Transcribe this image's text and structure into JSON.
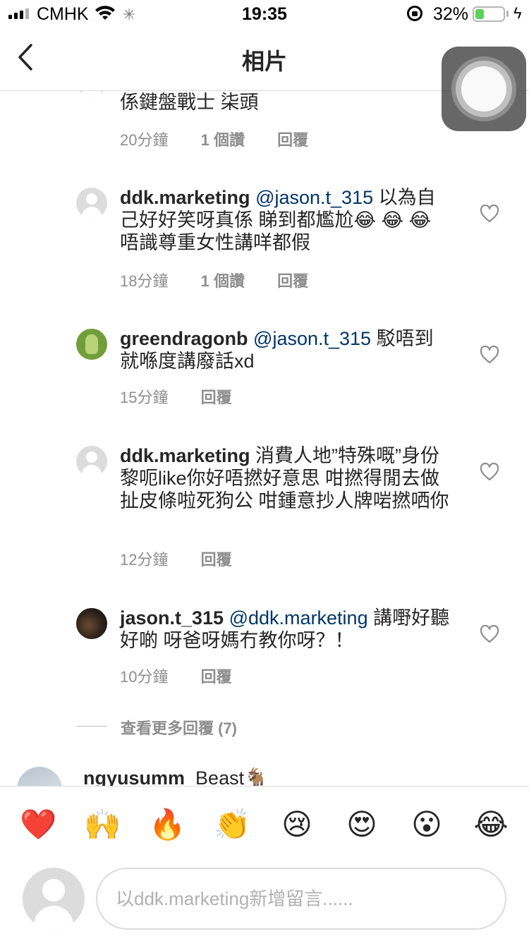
{
  "status_bar": {
    "carrier": "CMHK",
    "time": "19:35",
    "battery_percent": "32%",
    "battery_level": 0.32,
    "battery_color": "#5ad358"
  },
  "nav": {
    "title": "相片",
    "back_icon": "chevron-left-icon"
  },
  "comments": {
    "partial_top": {
      "text": "係鍵盤戰士 柒頭",
      "time": "20分鐘",
      "likes": "1 個讚",
      "reply": "回覆"
    },
    "items": [
      {
        "username": "ddk.marketing",
        "mention": "@jason.t_315",
        "text": " 以為自己好好笑呀真係 睇到都尷尬😂 😂 😂 唔識尊重女性講咩都假",
        "time": "18分鐘",
        "likes": "1 個讚",
        "reply": "回覆"
      },
      {
        "username": "greendragonb",
        "mention": "@jason.t_315",
        "text": " 駁唔到就喺度講廢話xd",
        "time": "15分鐘",
        "reply": "回覆"
      },
      {
        "username": "ddk.marketing",
        "mention": "",
        "text": " 消費人地”特殊嘅”身份黎呃like你好唔撚好意思 咁撚得閒去做扯皮條啦死狗公 咁鍾意抄人牌啱撚哂你",
        "time": "12分鐘",
        "reply": "回覆"
      },
      {
        "username": "jason.t_315",
        "mention": "@ddk.marketing",
        "text": " 講嘢好聽好啲 呀爸呀媽冇教你呀？！",
        "time": "10分鐘",
        "reply": "回覆"
      }
    ],
    "view_more": "查看更多回覆 (7)",
    "next": {
      "username": "ngyusumm",
      "text": "Beast🐐"
    }
  },
  "reactions": [
    "❤️",
    "🙌",
    "🔥",
    "👏",
    "😢",
    "😍",
    "😮",
    "😂"
  ],
  "composer": {
    "placeholder": "以ddk.marketing新增留言......"
  },
  "colors": {
    "mention": "#003569",
    "meta": "#8e8e8e",
    "divider": "#dbdbdb"
  }
}
